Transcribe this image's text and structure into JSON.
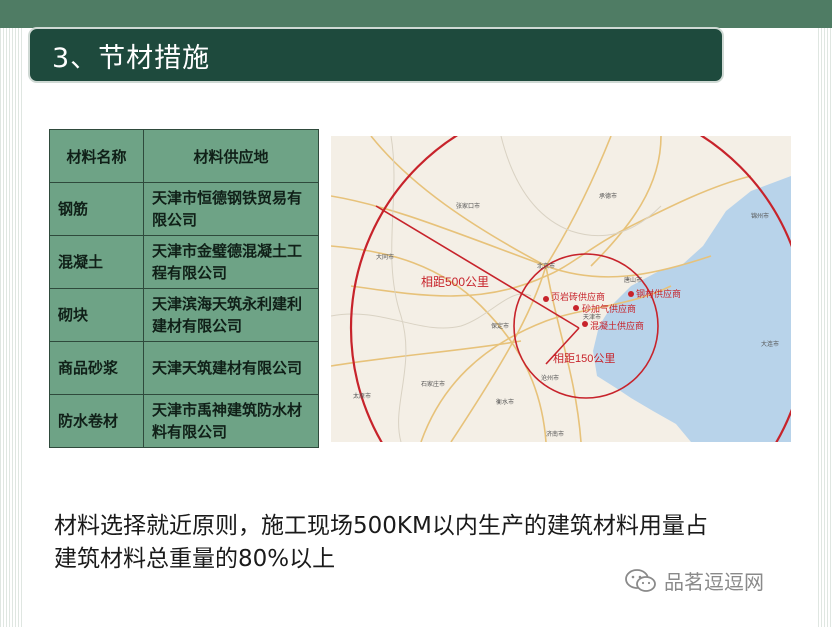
{
  "slide": {
    "title": "3、节材措施"
  },
  "table": {
    "header": {
      "col1": "材料名称",
      "col2": "材料供应地"
    },
    "rows": [
      {
        "name": "钢筋",
        "supplier": "天津市恒德钢铁贸易有限公司"
      },
      {
        "name": "混凝土",
        "supplier": "天津市金璧德混凝土工程有限公司"
      },
      {
        "name": "砌块",
        "supplier": "天津滨海天筑永利建利建材有限公司"
      },
      {
        "name": "商品砂浆",
        "supplier": "天津天筑建材有限公司"
      },
      {
        "name": "防水卷材",
        "supplier": "天津市禹神建筑防水材料有限公司"
      }
    ]
  },
  "map": {
    "label_500": "相距500公里",
    "label_150": "相距150公里",
    "supplier_labels": {
      "shale": "页岩砖供应商",
      "steel": "钢材供应商",
      "aerated": "砂加气供应商",
      "concrete": "混凝土供应商"
    },
    "city_labels": {
      "beijing": "北京市",
      "tianjin": "天津市",
      "tangshan": "唐山市",
      "shijiazhuang": "石家庄市",
      "taiyuan": "太原市",
      "datong": "大同市",
      "zhangjiakou": "张家口市",
      "chengde": "承德市",
      "baoding": "保定市",
      "cangzhou": "沧州市",
      "hengshui": "衡水市",
      "jinzhou": "锦州市",
      "dalian": "大连市",
      "jinan": "济南市"
    },
    "colors": {
      "circle": "#c7232b",
      "sea": "#b8d3ea",
      "land": "#f4efe6"
    }
  },
  "bottom_text": {
    "line1": "材料选择就近原则，施工现场500KM以内生产的建筑材料用量占",
    "line2": "建筑材料总重量的80%以上"
  },
  "watermark": {
    "text": "品茗逗逗网"
  }
}
